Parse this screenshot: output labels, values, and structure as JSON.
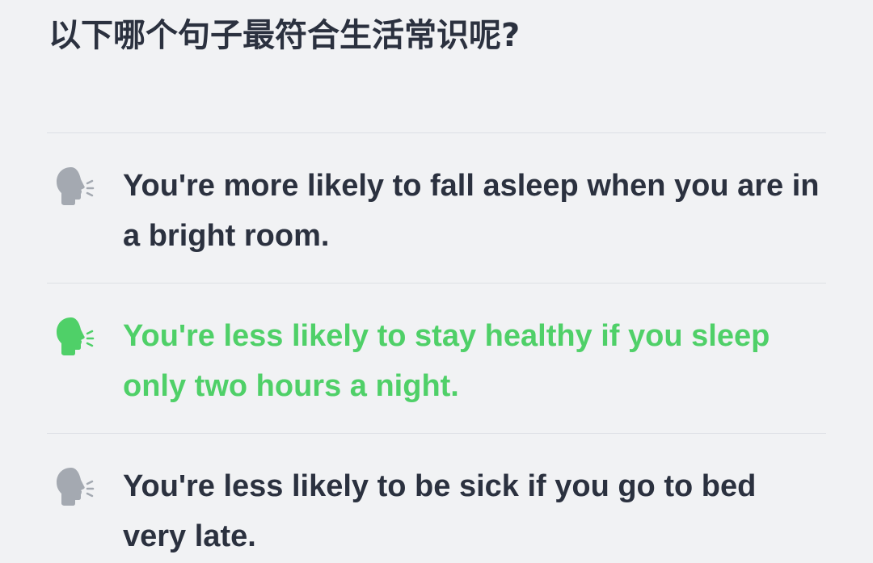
{
  "question": {
    "title": "以下哪个句子最符合生活常识呢?"
  },
  "colors": {
    "background": "#f1f2f4",
    "text": "#2b313f",
    "selected": "#4fd068",
    "icon_default": "#a4a9b1",
    "divider": "#dde0e5"
  },
  "options": [
    {
      "text": "You're more likely to fall asleep when you are in a bright room.",
      "icon": "speaking-head-icon",
      "selected": false
    },
    {
      "text": "You're less likely to stay healthy if you sleep only two hours a night.",
      "icon": "speaking-head-icon",
      "selected": true
    },
    {
      "text": "You're less likely to be sick if you go to bed very late.",
      "icon": "speaking-head-icon",
      "selected": false
    }
  ]
}
